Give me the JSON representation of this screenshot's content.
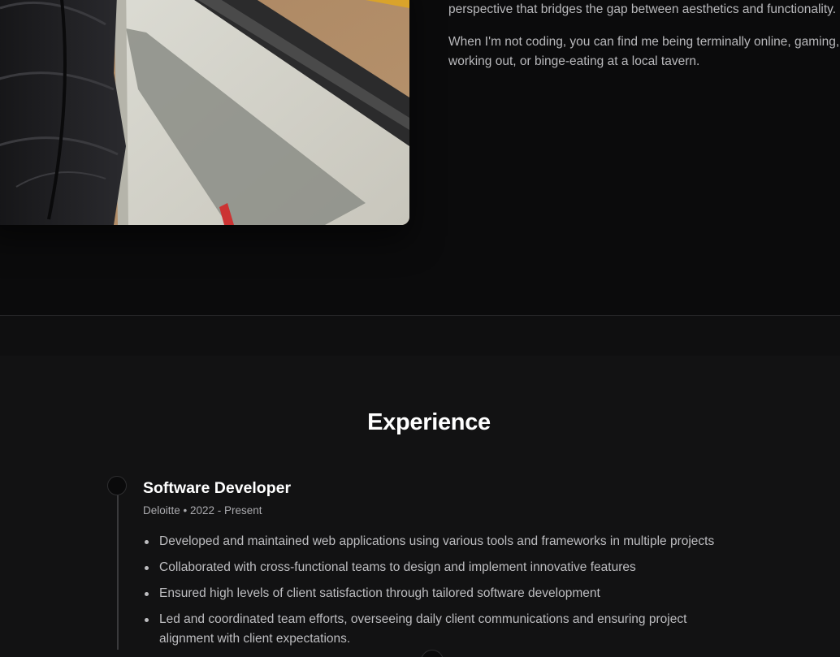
{
  "about": {
    "paragraph_1": "perspective that bridges the gap between aesthetics and functionality.",
    "paragraph_2": "When I'm not coding, you can find me being terminally online, gaming, working out, or binge-eating at a local tavern."
  },
  "experience": {
    "title": "Experience",
    "jobs": [
      {
        "title": "Software Developer",
        "meta": "Deloitte • 2022 - Present",
        "bullets": [
          "Developed and maintained web applications using various tools and frameworks in multiple projects",
          "Collaborated with cross-functional teams to design and implement innovative features",
          "Ensured high levels of client satisfaction through tailored software development",
          "Led and coordinated team efforts, overseeing daily client communications and ensuring project alignment with client expectations."
        ]
      }
    ]
  },
  "colors": {
    "background": "#0b0b0c",
    "section_background": "#121213",
    "heading": "#ffffff",
    "body_text": "#bdbdc0",
    "timeline_line": "#3a3a3c"
  }
}
